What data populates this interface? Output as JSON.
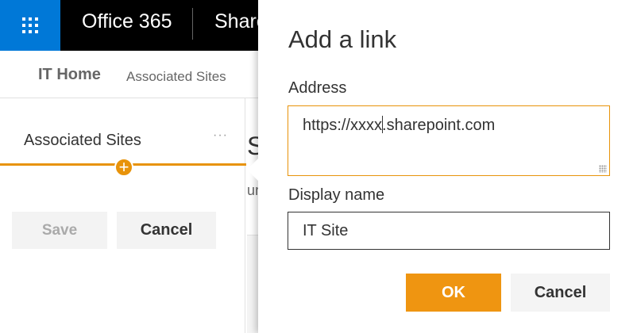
{
  "suite": {
    "brand": "Office 365",
    "app_name": "Share",
    "waffle_icon": "waffle-icon"
  },
  "site_nav": {
    "home": "IT Home",
    "associated": "Associated Sites"
  },
  "edit_panel": {
    "section_label": "Associated Sites",
    "more": "···",
    "insert_icon": "plus-circle-icon",
    "save_label": "Save",
    "cancel_label": "Cancel"
  },
  "page_peek": {
    "heading_fragment": "Si",
    "text_fragment": "ur"
  },
  "dialog": {
    "title": "Add a link",
    "address_label": "Address",
    "address_before_cursor": "https://xxxx",
    "address_after_cursor": ".sharepoint.com",
    "display_label": "Display name",
    "display_value": "IT Site",
    "ok_label": "OK",
    "cancel_label": "Cancel"
  },
  "colors": {
    "accent": "#ef9511",
    "brand_blue": "#0078d7",
    "suite_bar": "#000000"
  }
}
